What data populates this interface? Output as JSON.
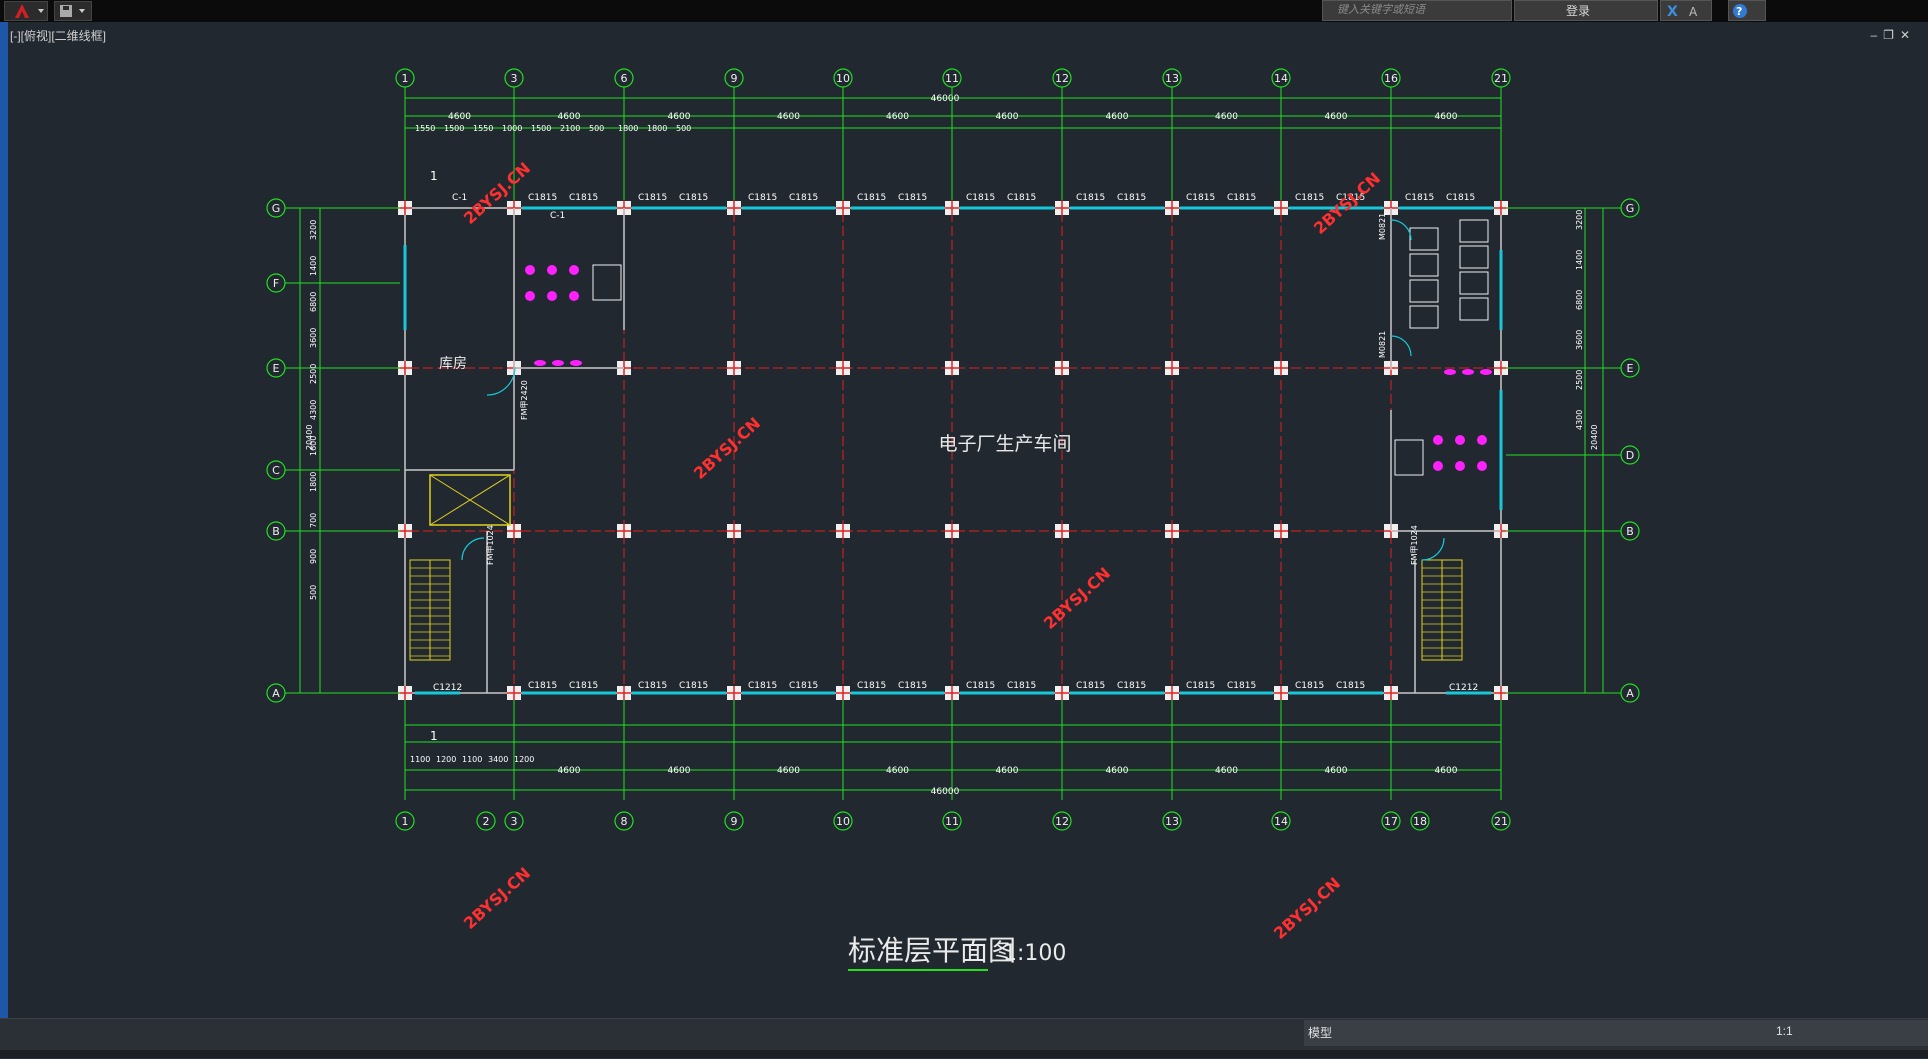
{
  "titlebar": {
    "search_placeholder": "键入关键字或短语",
    "login_label": "登录"
  },
  "viewport": {
    "label": "[-][俯视][二维线框]"
  },
  "drawing": {
    "title": "标准层平面图",
    "scale": "1:100",
    "room_main": "电子厂生产车间",
    "room_storage": "库房",
    "watermark": "2BYSJ.CN",
    "top_axes": [
      "1",
      "3",
      "6",
      "9",
      "10",
      "11",
      "12",
      "13",
      "14",
      "16",
      "21"
    ],
    "bottom_axes": [
      "1",
      "2",
      "3",
      "8",
      "9",
      "10",
      "11",
      "12",
      "13",
      "14",
      "17",
      "18",
      "21"
    ],
    "left_axes": [
      "G",
      "F",
      "E",
      "C",
      "B",
      "A"
    ],
    "right_axes": [
      "G",
      "E",
      "D",
      "B",
      "A"
    ],
    "total_dim": "46000",
    "bay_dim": "4600",
    "window_label": "C1815",
    "window_small": "C1212",
    "door_label": "M0821",
    "fire_door": "FM甲1024",
    "fire_door_2": "FM甲2420",
    "win_c1": "C-1",
    "section_mark": "1",
    "left_total": "20400",
    "top_sub": [
      "1550",
      "1500",
      "1550",
      "1000",
      "1500",
      "2100",
      "500",
      "1800",
      "1800",
      "500"
    ],
    "bot_sub": [
      "1100",
      "1200",
      "1100",
      "3400",
      "1200"
    ],
    "misc_dims": [
      "3200",
      "1400",
      "6800",
      "3600",
      "2500",
      "4300",
      "1600",
      "1800",
      "700",
      "900",
      "500"
    ]
  },
  "statusbar": {
    "model_label": "模型",
    "scale_label": "1:1"
  }
}
